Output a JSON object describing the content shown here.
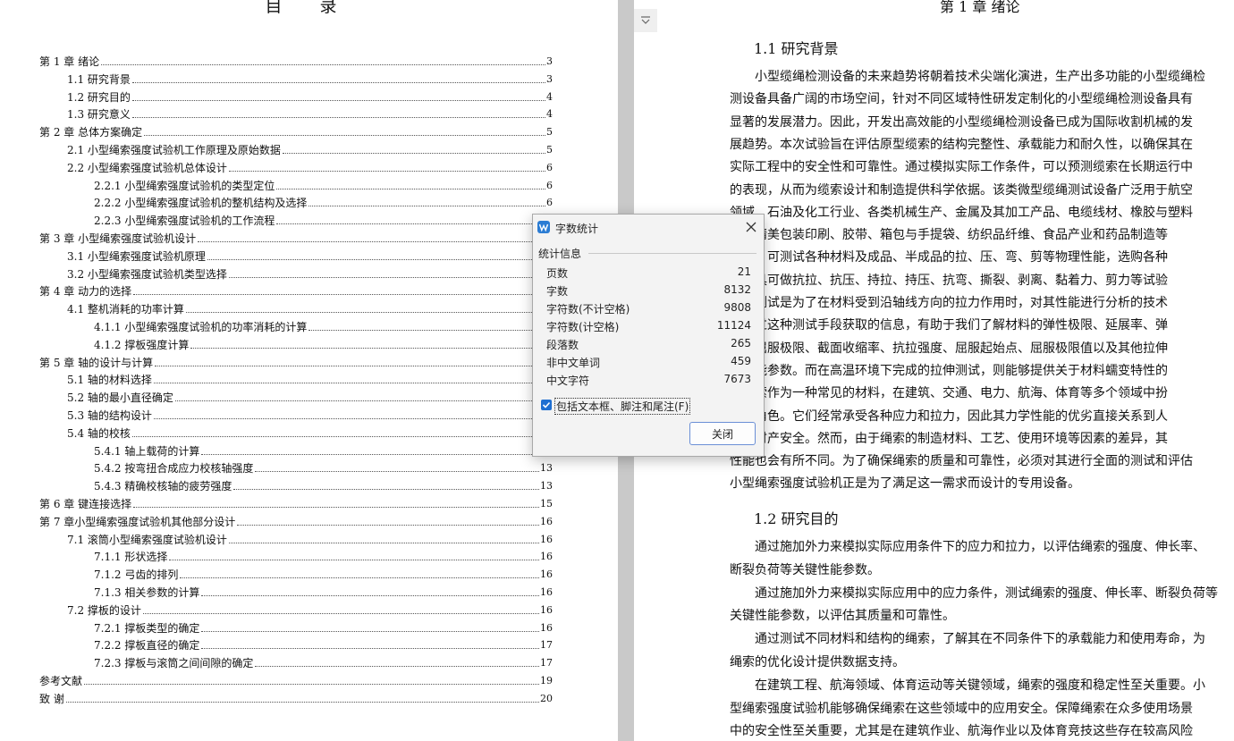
{
  "left_page": {
    "title": "目 录",
    "entries": [
      {
        "text": "第 1 章  绪论",
        "page": "3"
      },
      {
        "text": "1.1 研究背景",
        "page": "3"
      },
      {
        "text": "1.2 研究目的",
        "page": "4"
      },
      {
        "text": "1.3 研究意义",
        "page": "4"
      },
      {
        "text": "第 2 章  总体方案确定",
        "page": "5"
      },
      {
        "text": "2.1    小型绳索强度试验机工作原理及原始数据",
        "page": "5"
      },
      {
        "text": "2.2 小型绳索强度试验机总体设计",
        "page": "6"
      },
      {
        "text": "2.2.1 小型绳索强度试验机的类型定位",
        "page": "6"
      },
      {
        "text": "2.2.2  小型绳索强度试验机的整机结构及选择",
        "page": "6"
      },
      {
        "text": "2.2.3  小型绳索强度试验机的工作流程",
        "page": ""
      },
      {
        "text": "第 3 章  小型绳索强度试验机设计",
        "page": ""
      },
      {
        "text": "3.1    小型绳索强度试验机原理",
        "page": ""
      },
      {
        "text": "3.2    小型绳索强度试验机类型选择",
        "page": ""
      },
      {
        "text": "第 4 章  动力的选择",
        "page": ""
      },
      {
        "text": "4.1    整机消耗的功率计算",
        "page": ""
      },
      {
        "text": "4.1.1    小型绳索强度试验机的功率消耗的计算",
        "page": ""
      },
      {
        "text": "4.1.2    撑板强度计算",
        "page": ""
      },
      {
        "text": "第 5 章  轴的设计与计算",
        "page": ""
      },
      {
        "text": "5.1    轴的材料选择",
        "page": ""
      },
      {
        "text": "5.2    轴的最小直径确定",
        "page": ""
      },
      {
        "text": "5.3    轴的结构设计",
        "page": ""
      },
      {
        "text": "5.4    轴的校核",
        "page": ""
      },
      {
        "text": "5.4.1    轴上载荷的计算",
        "page": ""
      },
      {
        "text": "5.4.2    按弯扭合成应力校核轴强度",
        "page": "13"
      },
      {
        "text": "5.4.3    精确校核轴的疲劳强度",
        "page": "13"
      },
      {
        "text": "第 6 章  键连接选择",
        "page": "15"
      },
      {
        "text": "第 7 章小型绳索强度试验机其他部分设计",
        "page": "16"
      },
      {
        "text": "7.1  滚筒小型绳索强度试验机设计",
        "page": "16"
      },
      {
        "text": "7.1.1    形状选择",
        "page": "16"
      },
      {
        "text": "7.1.2    弓齿的排列",
        "page": "16"
      },
      {
        "text": "7.1.3    相关参数的计算",
        "page": "16"
      },
      {
        "text": "7.2 撑板的设计",
        "page": "16"
      },
      {
        "text": "7.2.1    撑板类型的确定",
        "page": "16"
      },
      {
        "text": "7.2.2    撑板直径的确定",
        "page": "17"
      },
      {
        "text": "7.2.3    撑板与滚筒之间间隙的确定",
        "page": "17"
      },
      {
        "text": "参考文献",
        "page": "19"
      },
      {
        "text": "致    谢",
        "page": "20"
      }
    ]
  },
  "right_page": {
    "chapter_title": "第 1 章  绪论",
    "h_background": "1.1 研究背景",
    "h_purpose": "1.2 研究目的",
    "lines": [
      "　　小型缆绳检测设备的未来趋势将朝着技术尖端化演进，生产出多功能的小型缆绳检",
      "测设备具备广阔的市场空间，针对不同区域特性研发定制化的小型缆绳检测设备具有",
      "显著的发展潜力。因此，开发出高效能的小型缆绳检测设备已成为国际收割机械的发",
      "展趋势。本次试验旨在评估原型缆索的结构完整性、承载能力和耐久性，以确保其在",
      "实际工程中的安全性和可靠性。通过模拟实际工作条件，可以预测缆索在长期运行中",
      "的表现，从而为缆索设计和制造提供科学依据。该类微型缆绳测试设备广泛用于航空",
      "领域、石油及化工行业、各类机械生产、金属及其加工产品、电缆线材、橡胶与塑料",
      "以及精美包装印刷、胶带、箱包与手提袋、纺织品纤维、食品产业和药品制造等",
      "领域。可测试各种材料及成品、半成品的拉、压、弯、剪等物理性能，选购各种",
      "的夹具可做抗拉、抗压、持拉、持压、抗弯、撕裂、剥离、黏着力、剪力等试验",
      "拉伸测试是为了在材料受到沿轴线方向的拉力作用时，对其性能进行分析的技术",
      "。通过这种测试手段获取的信息，有助于我们了解材料的弹性极限、延展率、弹",
      "数、屈服极限、截面收缩率、抗拉强度、屈服起始点、屈服极限值以及其他拉伸",
      "的性能参数。而在高温环境下完成的拉伸测试，则能够提供关于材料蠕变特性的",
      "　绳索作为一种常见的材料，在建筑、交通、电力、航海、体育等多个领域中扮",
      "关键角色。它们经常承受各种应力和拉力，因此其力学性能的优劣直接关系到人",
      "命和财产安全。然而，由于绳索的制造材料、工艺、使用环境等因素的差异，其",
      "性能也会有所不同。为了确保绳索的质量和可靠性，必须对其进行全面的测试和评估",
      "小型绳索强度试验机正是为了满足这一需求而设计的专用设备。"
    ],
    "lines2": [
      "　　通过施加外力来模拟实际应用条件下的应力和拉力，以评估绳索的强度、伸长率、",
      "断裂负荷等关键性能参数。",
      "　　通过施加外力来模拟实际应用中的应力条件，测试绳索的强度、伸长率、断裂负荷等",
      "关键性能参数，以评估其质量和可靠性。",
      "　　通过测试不同材料和结构的绳索，了解其在不同条件下的承载能力和使用寿命，为",
      "绳索的优化设计提供数据支持。",
      "　　在建筑工程、航海领域、体育运动等关键领域，绳索的强度和稳定性至关重要。小",
      "型绳索强度试验机能够确保绳索在这些领域中的应用安全。保障绳索在众多使用场景",
      "中的安全性至关重要，尤其是在建筑作业、航海作业以及体育竞技这些存在较高风险"
    ]
  },
  "dialog": {
    "title": "字数统计",
    "section": "统计信息",
    "stats": [
      {
        "label": "页数",
        "value": "21"
      },
      {
        "label": "字数",
        "value": "8132"
      },
      {
        "label": "字符数(不计空格)",
        "value": "9808"
      },
      {
        "label": "字符数(计空格)",
        "value": "11124"
      },
      {
        "label": "段落数",
        "value": "265"
      },
      {
        "label": "非中文单词",
        "value": "459"
      },
      {
        "label": "中文字符",
        "value": "7673"
      }
    ],
    "checkbox_label": "包括文本框、脚注和尾注(F)",
    "checkbox_checked": true,
    "close_button": "关闭"
  },
  "colors": {
    "accent": "#1f6fd1",
    "gutter": "#c9c9c9",
    "dialog_bg": "#f3f3f3"
  }
}
